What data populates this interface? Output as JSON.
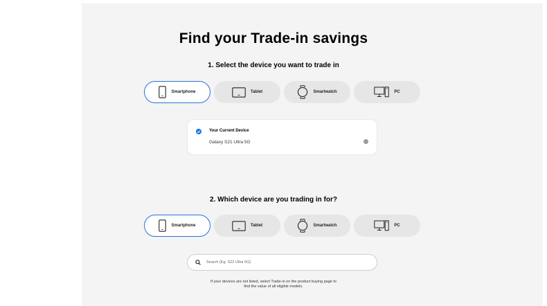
{
  "page": {
    "title": "Find your Trade-in savings"
  },
  "step1": {
    "heading": "1. Select the device you want to trade in",
    "chips": [
      {
        "label": "Smartphone",
        "icon": "smartphone-icon",
        "active": true
      },
      {
        "label": "Tablet",
        "icon": "tablet-icon",
        "active": false
      },
      {
        "label": "Smartwatch",
        "icon": "smartwatch-icon",
        "active": false
      },
      {
        "label": "PC",
        "icon": "pc-icon",
        "active": false
      }
    ]
  },
  "current_device": {
    "label": "Your Current Device",
    "value": "Galaxy S21 Ultra 5G"
  },
  "step2": {
    "heading": "2. Which device are you trading in for?",
    "chips": [
      {
        "label": "Smartphone",
        "icon": "smartphone-icon",
        "active": true
      },
      {
        "label": "Tablet",
        "icon": "tablet-icon",
        "active": false
      },
      {
        "label": "Smartwatch",
        "icon": "smartwatch-icon",
        "active": false
      },
      {
        "label": "PC",
        "icon": "pc-icon",
        "active": false
      }
    ]
  },
  "search": {
    "placeholder": "Search (Eg: S22 Ultra 5G)"
  },
  "note": {
    "line1": "If your devices are not listed, select Trade-in on the product buying page to",
    "line2": "find the value of all eligible models."
  },
  "colors": {
    "accent": "#1a73e8",
    "chip_active_border": "#2a6fdb",
    "chip_bg": "#e6e6e6",
    "panel_bg": "#f4f4f4"
  }
}
